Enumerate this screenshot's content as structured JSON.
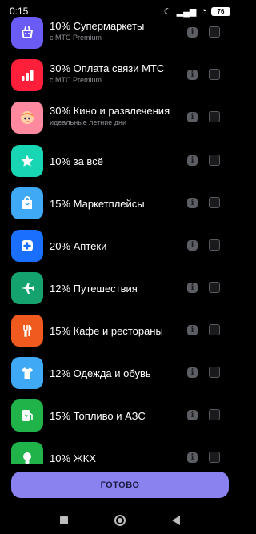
{
  "status": {
    "time": "0:15",
    "battery": "76"
  },
  "categories": [
    {
      "title": "10% Супермаркеты",
      "subtitle": "с МТС Premium",
      "color": "#6a5bf5",
      "icon": "basket-icon"
    },
    {
      "title": "30% Оплата связи МТС",
      "subtitle": "с МТС Premium",
      "color": "#ff1f3a",
      "icon": "signal-bars-icon"
    },
    {
      "title": "30% Кино и развлечения",
      "subtitle": "идеальные летние дни",
      "color": "#ff8aa0",
      "icon": "cartoon-character-icon"
    },
    {
      "title": "10% за всё",
      "subtitle": "",
      "color": "#18d6b4",
      "icon": "star-icon"
    },
    {
      "title": "15% Маркетплейсы",
      "subtitle": "",
      "color": "#3fa9f5",
      "icon": "shopping-bag-icon"
    },
    {
      "title": "20% Аптеки",
      "subtitle": "",
      "color": "#1a6fff",
      "icon": "medical-cross-icon"
    },
    {
      "title": "12% Путешествия",
      "subtitle": "",
      "color": "#14a36e",
      "icon": "airplane-icon"
    },
    {
      "title": "15% Кафе и рестораны",
      "subtitle": "",
      "color": "#f05a1e",
      "icon": "fork-knife-icon"
    },
    {
      "title": "12% Одежда и обувь",
      "subtitle": "",
      "color": "#3fa9f5",
      "icon": "tshirt-icon"
    },
    {
      "title": "15% Топливо и АЗС",
      "subtitle": "",
      "color": "#1fb34a",
      "icon": "fuel-icon"
    },
    {
      "title": "10% ЖКХ",
      "subtitle": "",
      "color": "#1fb34a",
      "icon": "lightbulb-icon"
    }
  ],
  "done_button": "ГОТОВО"
}
